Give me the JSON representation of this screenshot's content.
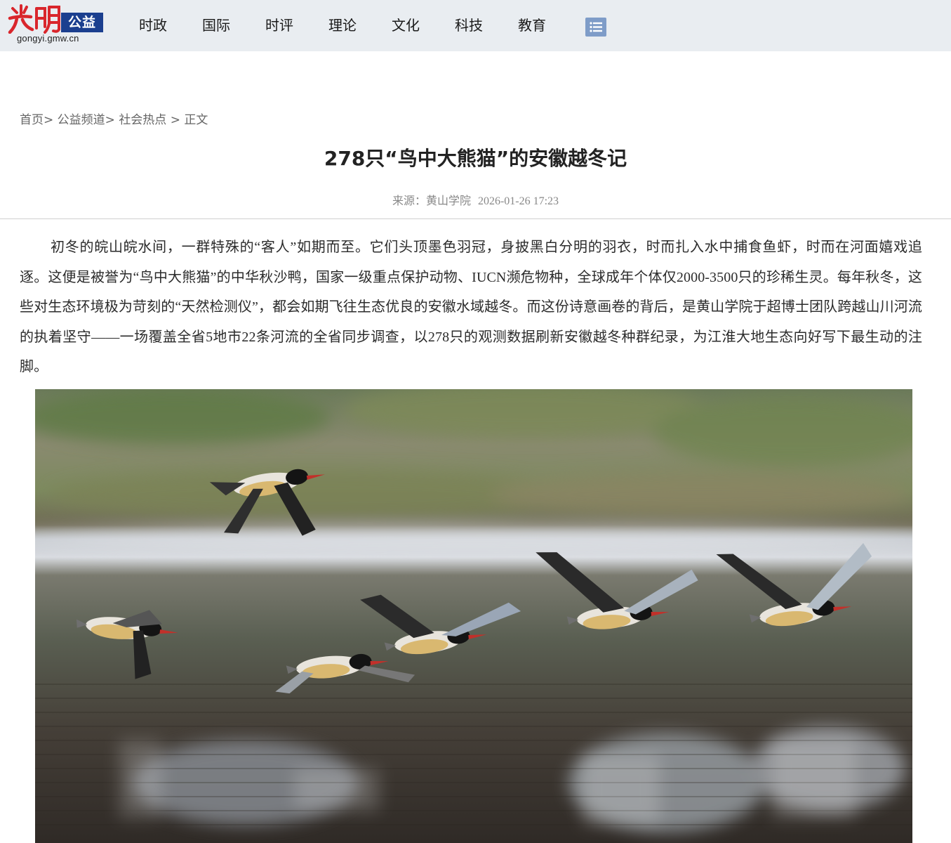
{
  "header": {
    "logo_text": "光明",
    "logo_badge": "公益",
    "logo_url": "gongyi.gmw.cn",
    "nav": [
      "时政",
      "国际",
      "时评",
      "理论",
      "文化",
      "科技",
      "教育"
    ],
    "menu_icon": "list-menu-icon"
  },
  "breadcrumb": {
    "home": "首页",
    "channel": "公益频道",
    "section": "社会热点",
    "current": "正文"
  },
  "article": {
    "title": "278只“鸟中大熊猫”的安徽越冬记",
    "source": "来源：黄山学院",
    "time": "2026-01-26 17:23",
    "paragraph": "初冬的皖山皖水间，一群特殊的“客人”如期而至。它们头顶墨色羽冠，身披黑白分明的羽衣，时而扎入水中捕食鱼虾，时而在河面嬉戏追逐。这便是被誉为“鸟中大熊猫”的中华秋沙鸭，国家一级重点保护动物、IUCN濒危物种，全球成年个体仅2000-3500只的珍稀生灵。每年秋冬，这些对生态环境极为苛刻的“天然检测仪”，都会如期飞往生态优良的安徽水域越冬。而这份诗意画卷的背后，是黄山学院于超博士团队跨越山川河流的执着坚守——一场覆盖全省5地市22条河流的全省同步调查，以278只的观测数据刷新安徽越冬种群纪录，为江淮大地生态向好写下最生动的注脚。"
  },
  "colors": {
    "header_bg": "#e9edf1",
    "logo_red": "#d9262c",
    "badge_blue": "#1b3f8f",
    "menu_blue": "#7e9cc8"
  }
}
